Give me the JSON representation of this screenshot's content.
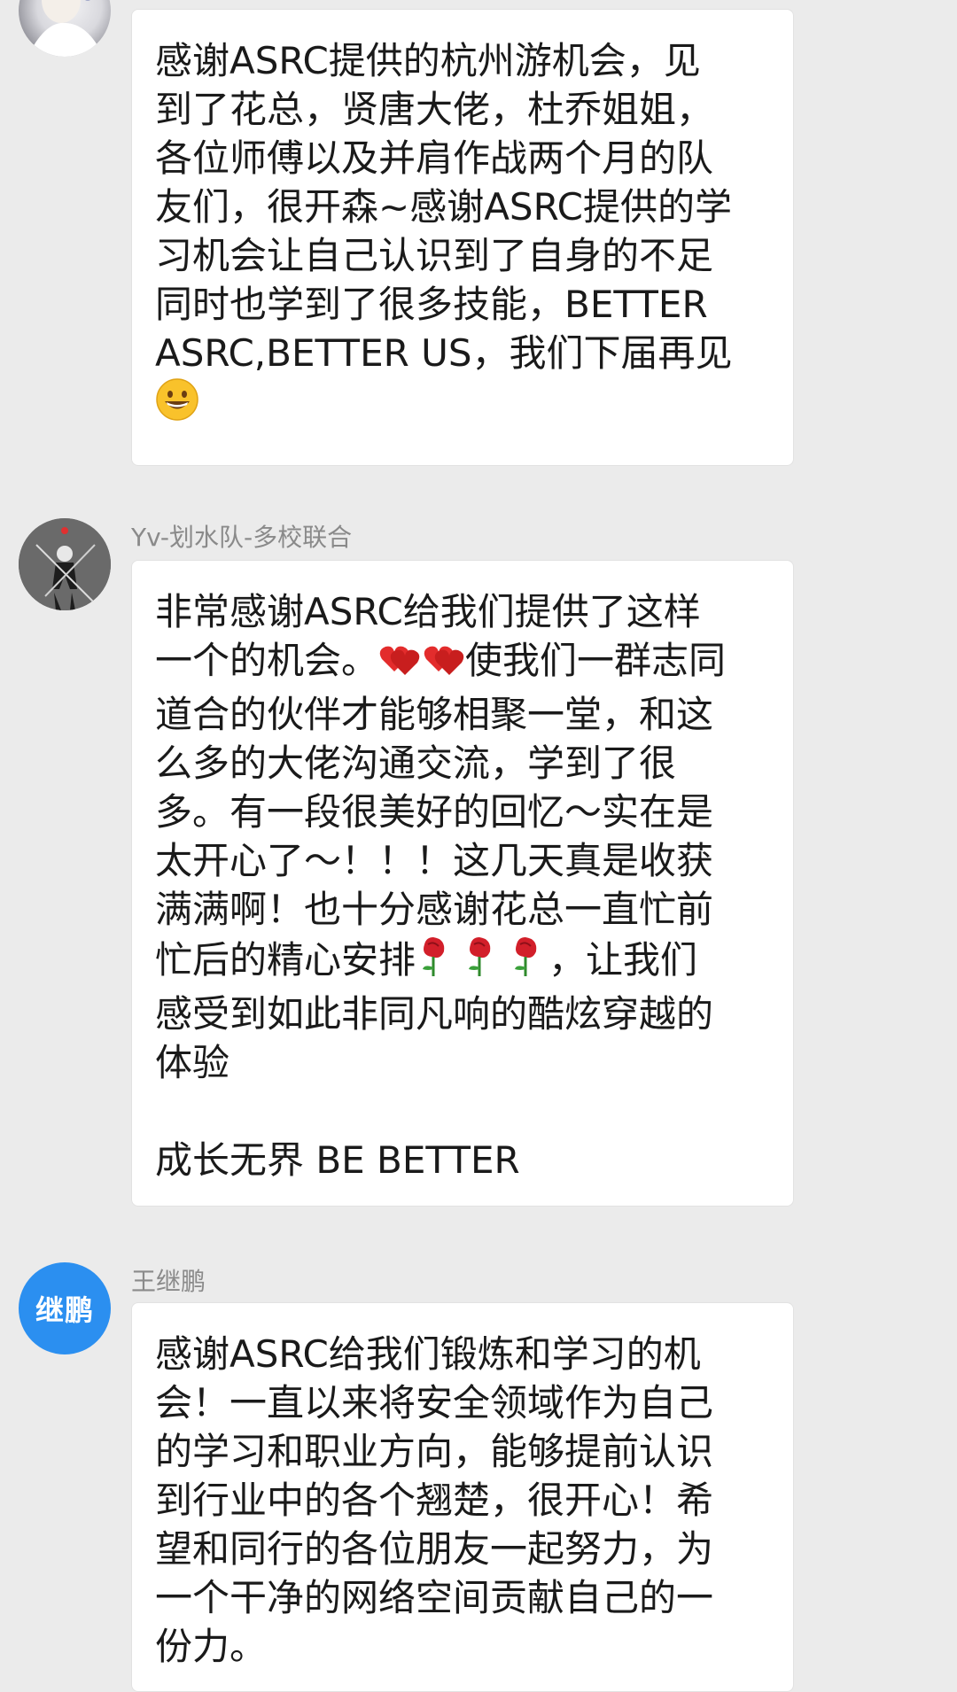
{
  "messages": [
    {
      "sender": "",
      "avatar_icon": "girl-portrait-avatar",
      "text_parts": [
        "感谢ASRC提供的杭州游机会，见\n到了花总，贤唐大佬，杜乔姐姐，\n各位师傅以及并肩作战两个月的队\n友们，很开森~感谢ASRC提供的学\n习机会让自己认识到了自身的不足\n同时也学到了很多技能，BETTER\nASRC,BETTER US，我们下届再见\n"
      ],
      "emojis": [
        "grinning-face-emoji"
      ]
    },
    {
      "sender": "Yv-划水队-多校联合",
      "avatar_icon": "swordsman-avatar",
      "text_parts": [
        "非常感谢ASRC给我们提供了这样\n一个的机会。",
        "使我们一群志同\n道合的伙伴才能够相聚一堂，和这\n么多的大佬沟通交流，学到了很\n多。有一段很美好的回忆～实在是\n太开心了～！！！这几天真是收获\n满满啊！也十分感谢花总一直忙前\n忙后的精心安排",
        "，让我们\n感受到如此非同凡响的酷炫穿越的\n体验\n\n成长无界 BE BETTER"
      ],
      "emojis": [
        "two-hearts-emoji",
        "rose-emoji"
      ]
    },
    {
      "sender": "王继鹏",
      "avatar_label": "继鹏",
      "avatar_icon": "text-avatar",
      "text_parts": [
        "感谢ASRC给我们锻炼和学习的机\n会！一直以来将安全领域作为自己\n的学习和职业方向，能够提前认识\n到行业中的各个翘楚，很开心！希\n望和同行的各位朋友一起努力，为\n一个干净的网络空间贡献自己的一\n份力。"
      ]
    }
  ],
  "colors": {
    "background": "#ebebeb",
    "bubble": "#ffffff",
    "sender_text": "#8a8a8a",
    "message_text": "#1a1a1a",
    "avatar_blue": "#2b8ff0"
  }
}
